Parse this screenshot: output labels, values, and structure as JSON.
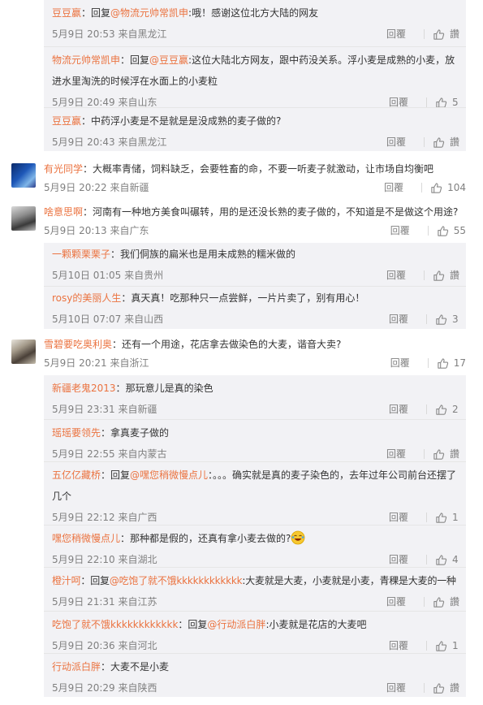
{
  "labels": {
    "reply": "回覆",
    "like_text": "讚"
  },
  "colors": {
    "username": "#eb7340",
    "meta": "#808080",
    "reply_bg": "#f2f2f5"
  },
  "block1": [
    {
      "user": "豆豆赢",
      "prefix": "：回复",
      "mention": "@物流元帅常凯申",
      "text": ":哦！感谢这位北方大陆的网友",
      "time": "5月9日 20:53 来自黑龙江",
      "like": ""
    },
    {
      "user": "物流元帅常凯申",
      "prefix": "：回复",
      "mention": "@豆豆赢",
      "text": ":这位大陆北方网友，跟中药没关系。浮小麦是成熟的小麦，放进水里淘洗的时候浮在水面上的小麦粒",
      "time": "5月9日 20:49 来自山东",
      "like": "5"
    },
    {
      "user": "豆豆赢",
      "prefix": "：",
      "mention": "",
      "text": "中药浮小麦是不是就是是没成熟的麦子做的?",
      "time": "5月9日 20:43 来自黑龙江",
      "like": ""
    }
  ],
  "top1": {
    "user": "有光同学",
    "text": "：大概率青储，饲料缺乏，会要牲畜的命，不要一听麦子就激动，让市场自均衡吧",
    "time": "5月9日 20:22 来自新疆",
    "like": "104"
  },
  "top2": {
    "user": "啥意思啊",
    "text": "：河南有一种地方美食叫碾转，用的是还没长熟的麦子做的，不知道是不是做这个用途?",
    "time": "5月9日 20:13 来自广东",
    "like": "55"
  },
  "block2": [
    {
      "user": "一颗颗栗栗子",
      "prefix": "：",
      "mention": "",
      "text": "我们侗族的扁米也是用未成熟的糯米做的",
      "time": "5月10日 01:05 来自贵州",
      "like": ""
    },
    {
      "user": "rosy的美丽人生",
      "prefix": "：",
      "mention": "",
      "text": "真天真！吃那种只一点尝鲜，一片片卖了，别有用心！",
      "time": "5月10日 07:07 来自山西",
      "like": "3"
    }
  ],
  "top3": {
    "user": "雪碧要吃奥利奥",
    "text": "：还有一个用途，花店拿去做染色的大麦，谐音大卖?",
    "time": "5月9日 20:21 来自浙江",
    "like": "17"
  },
  "block3": [
    {
      "user": "新疆老鬼2013",
      "prefix": "：",
      "mention": "",
      "text": "那玩意儿是真的染色",
      "time": "5月9日 23:31 来自新疆",
      "like": "2"
    },
    {
      "user": "瑶瑶要领先",
      "prefix": "：",
      "mention": "",
      "text": "拿真麦子做的",
      "time": "5月9日 22:55 来自内蒙古",
      "like": ""
    },
    {
      "user": "五亿亿藏桥",
      "prefix": "：回复",
      "mention": "@嘿您稍微慢点儿",
      "text": "：。。。确实就是真的麦子染色的，去年过年公司前台还摆了几个",
      "time": "5月9日 22:12 来自广西",
      "like": "1"
    },
    {
      "user": "嘿您稍微慢点儿",
      "prefix": "：",
      "mention": "",
      "text": "那种都是假的，还真有拿小麦去做的?",
      "time": "5月9日 22:10 来自湖北",
      "like": "4"
    },
    {
      "user": "橙汁呵",
      "prefix": "：回复",
      "mention": "@吃饱了就不饿kkkkkkkkkkkk",
      "text": ":大麦就是大麦，小麦就是小麦，青稞是大麦的一种",
      "time": "5月9日 21:31 来自江苏",
      "like": ""
    },
    {
      "user": "吃饱了就不饿kkkkkkkkkkkk",
      "prefix": "：回复",
      "mention": "@行动派白胖",
      "text": ":小麦就是花店的大麦吧",
      "time": "5月9日 20:36 来自河北",
      "like": "1"
    },
    {
      "user": "行动派白胖",
      "prefix": "：",
      "mention": "",
      "text": "大麦不是小麦",
      "time": "5月9日 20:29 来自陕西",
      "like": ""
    }
  ]
}
